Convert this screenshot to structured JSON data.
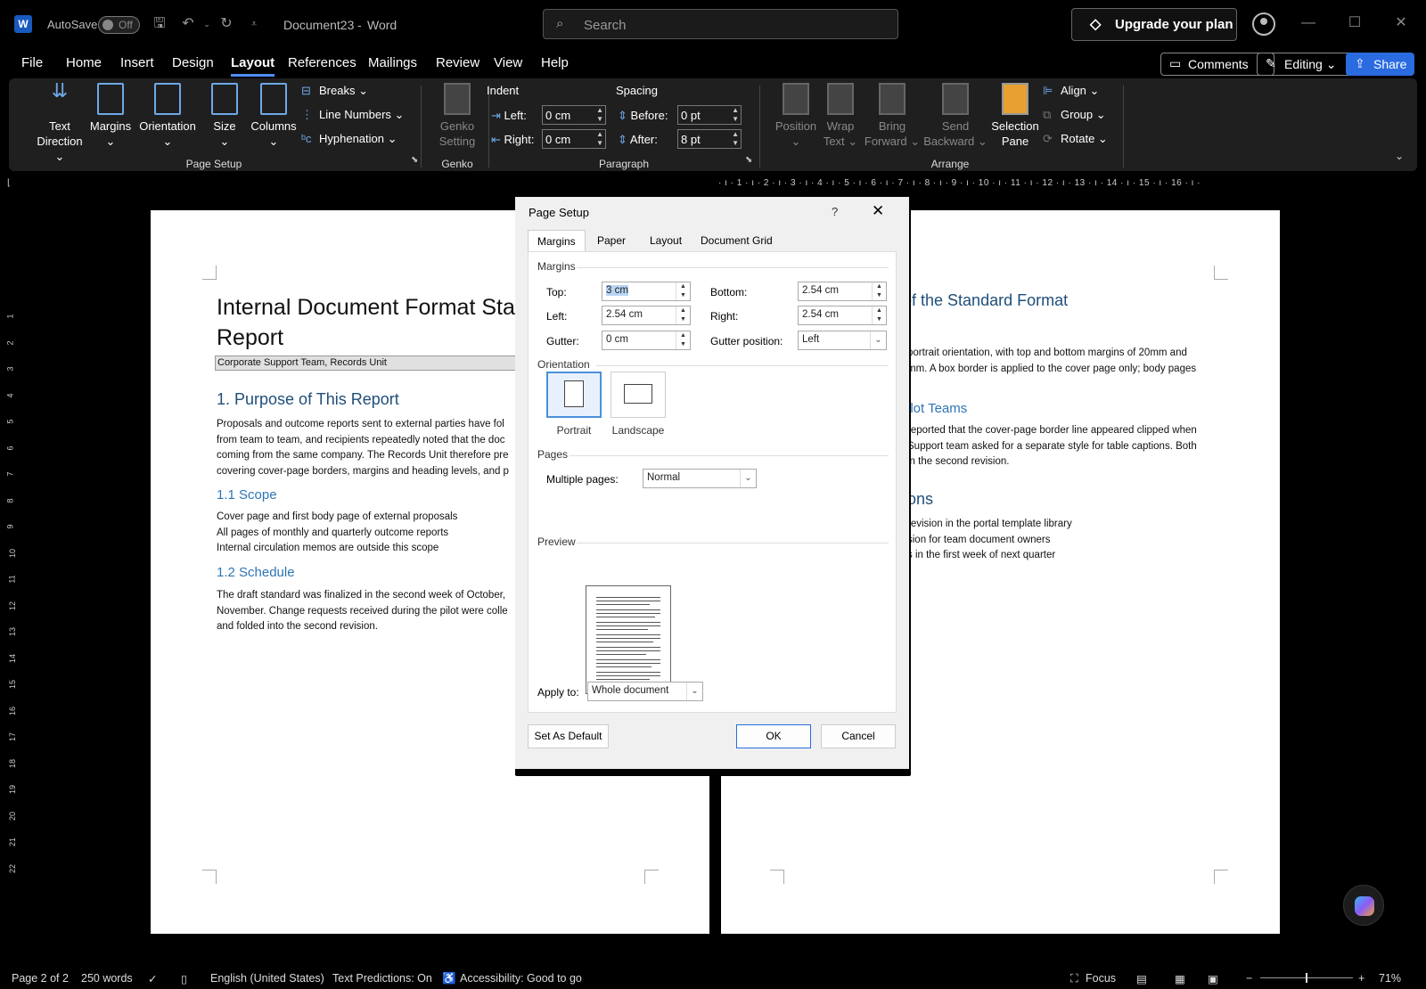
{
  "titlebar": {
    "app_logo": "W",
    "autosave_label": "AutoSave",
    "autosave_state": "Off",
    "doc_name": "Document23",
    "separator": "-",
    "app_name": "Word",
    "search_placeholder": "Search",
    "upgrade_label": "Upgrade your plan"
  },
  "menu": {
    "tabs": [
      "File",
      "Home",
      "Insert",
      "Design",
      "Layout",
      "References",
      "Mailings",
      "Review",
      "View",
      "Help"
    ],
    "active": "Layout",
    "comments_label": "Comments",
    "editing_label": "Editing",
    "share_label": "Share"
  },
  "ribbon": {
    "text_direction": [
      "Text",
      "Direction"
    ],
    "margins": "Margins",
    "orientation": "Orientation",
    "size": "Size",
    "columns": "Columns",
    "breaks": "Breaks",
    "line_numbers": "Line Numbers",
    "hyphenation": "Hyphenation",
    "page_setup_group": "Page Setup",
    "genko": [
      "Genko",
      "Setting"
    ],
    "genko_group": "Genko",
    "indent_header": "Indent",
    "spacing_header": "Spacing",
    "left_label": "Left:",
    "right_label": "Right:",
    "before_label": "Before:",
    "after_label": "After:",
    "indent_left": "0 cm",
    "indent_right": "0 cm",
    "spacing_before": "0 pt",
    "spacing_after": "8 pt",
    "paragraph_group": "Paragraph",
    "position": "Position",
    "wrap_text": [
      "Wrap",
      "Text"
    ],
    "bring_forward": [
      "Bring",
      "Forward"
    ],
    "send_backward": [
      "Send",
      "Backward"
    ],
    "selection_pane": [
      "Selection",
      "Pane"
    ],
    "align": "Align",
    "group": "Group",
    "rotate": "Rotate",
    "arrange_group": "Arrange"
  },
  "ruler": {
    "top": "· ı · 1 · ı · 2 · ı · 3 · ı · 4 · ı · 5 · ı · 6 · ı · 7 · ı · 8 · ı · 9 · ı · 10 · ı · 11 · ı · 12 · ı · 13 · ı · 14 · ı · 15 · ı · 16 · ı ·",
    "left": [
      "1",
      "2",
      "3",
      "4",
      "5",
      "6",
      "7",
      "8",
      "9",
      "10",
      "11",
      "12",
      "13",
      "14",
      "15",
      "16",
      "17",
      "18",
      "19",
      "20",
      "21",
      "22"
    ]
  },
  "page1": {
    "title_line1": "Internal Document Format Sta",
    "title_line2": "Report",
    "subtitle": "Corporate Support Team, Records Unit",
    "h1": "1. Purpose of This Report",
    "p1": [
      "Proposals and outcome reports sent to external parties have fol",
      "from team to team, and recipients repeatedly noted that the doc",
      "coming from the same company. The Records Unit therefore pre",
      "covering cover-page borders, margins and heading levels, and p"
    ],
    "h2_scope": "1.1 Scope",
    "scope": [
      "Cover page and first body page of external proposals",
      "All pages of monthly and quarterly outcome reports",
      "Internal circulation memos are outside this scope"
    ],
    "h2_schedule": "1.2 Schedule",
    "schedule": [
      "The draft standard was finalized in the second week of October,",
      "November. Change requests received during the pilot were colle",
      "and folded into the second revision."
    ]
  },
  "page2": {
    "h1": "of the Standard Format",
    "p1": [
      "portrait orientation, with top and bottom margins of 20mm and",
      "mm. A box border is applied to the cover page only; body pages"
    ],
    "h2": "ilot Teams",
    "p2": [
      "reported that the cover-page border line appeared clipped when",
      "Support team asked for a separate style for table captions. Both",
      "in the second revision."
    ],
    "h1b": "ons",
    "p3": [
      "revision in the portal template library",
      "sion for team document owners",
      "s in the first week of next quarter"
    ]
  },
  "dialog": {
    "title": "Page Setup",
    "help": "?",
    "tabs": [
      "Margins",
      "Paper",
      "Layout",
      "Document Grid"
    ],
    "margins_section": "Margins",
    "top_label": "Top:",
    "top_value": "3 cm",
    "bottom_label": "Bottom:",
    "bottom_value": "2.54 cm",
    "left_label": "Left:",
    "left_value": "2.54 cm",
    "right_label": "Right:",
    "right_value": "2.54 cm",
    "gutter_label": "Gutter:",
    "gutter_value": "0 cm",
    "gutter_pos_label": "Gutter position:",
    "gutter_pos_value": "Left",
    "orientation_section": "Orientation",
    "portrait": "Portrait",
    "landscape": "Landscape",
    "pages_section": "Pages",
    "multiple_pages_label": "Multiple pages:",
    "multiple_pages_value": "Normal",
    "preview_section": "Preview",
    "apply_to_label": "Apply to:",
    "apply_to_value": "Whole document",
    "set_default": "Set As Default",
    "ok": "OK",
    "cancel": "Cancel"
  },
  "status": {
    "page": "Page 2 of 2",
    "words": "250 words",
    "language": "English (United States)",
    "predictions": "Text Predictions: On",
    "accessibility": "Accessibility: Good to go",
    "focus": "Focus",
    "zoom": "71%"
  },
  "colors": {
    "accent": "#4c8df6",
    "heading": "#1f4e79",
    "share": "#2a6be0"
  }
}
